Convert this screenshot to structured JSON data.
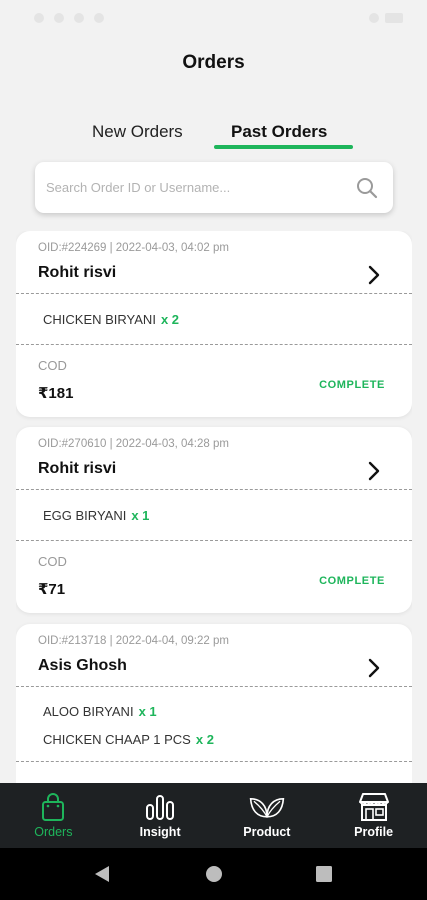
{
  "header": {
    "title": "Orders"
  },
  "tabs": {
    "new_label": "New Orders",
    "past_label": "Past Orders",
    "active": "past"
  },
  "search": {
    "placeholder": "Search Order ID or Username..."
  },
  "orders": [
    {
      "oid_line": "OID:#224269 | 2022-04-03, 04:02 pm",
      "customer": "Rohit risvi",
      "items": [
        {
          "name": "CHICKEN BIRYANI",
          "qty": "x 2"
        }
      ],
      "payment": "COD",
      "amount": "₹181",
      "status": "COMPLETE"
    },
    {
      "oid_line": "OID:#270610 | 2022-04-03, 04:28 pm",
      "customer": "Rohit risvi",
      "items": [
        {
          "name": "EGG BIRYANI",
          "qty": "x 1"
        }
      ],
      "payment": "COD",
      "amount": "₹71",
      "status": "COMPLETE"
    },
    {
      "oid_line": "OID:#213718 | 2022-04-04, 09:22 pm",
      "customer": "Asis Ghosh",
      "items": [
        {
          "name": "ALOO BIRYANI",
          "qty": "x 1"
        },
        {
          "name": "CHICKEN CHAAP 1 PCS",
          "qty": "x 2"
        }
      ]
    }
  ],
  "bottom_nav": {
    "items": [
      {
        "label": "Orders",
        "icon": "shopping-bag-icon",
        "active": true
      },
      {
        "label": "Insight",
        "icon": "bar-chart-icon"
      },
      {
        "label": "Product",
        "icon": "leaves-icon"
      },
      {
        "label": "Profile",
        "icon": "store-icon"
      }
    ]
  },
  "colors": {
    "accent": "#1eb55b",
    "nav_background": "#1e2123",
    "page_background": "#f2f2f2"
  }
}
